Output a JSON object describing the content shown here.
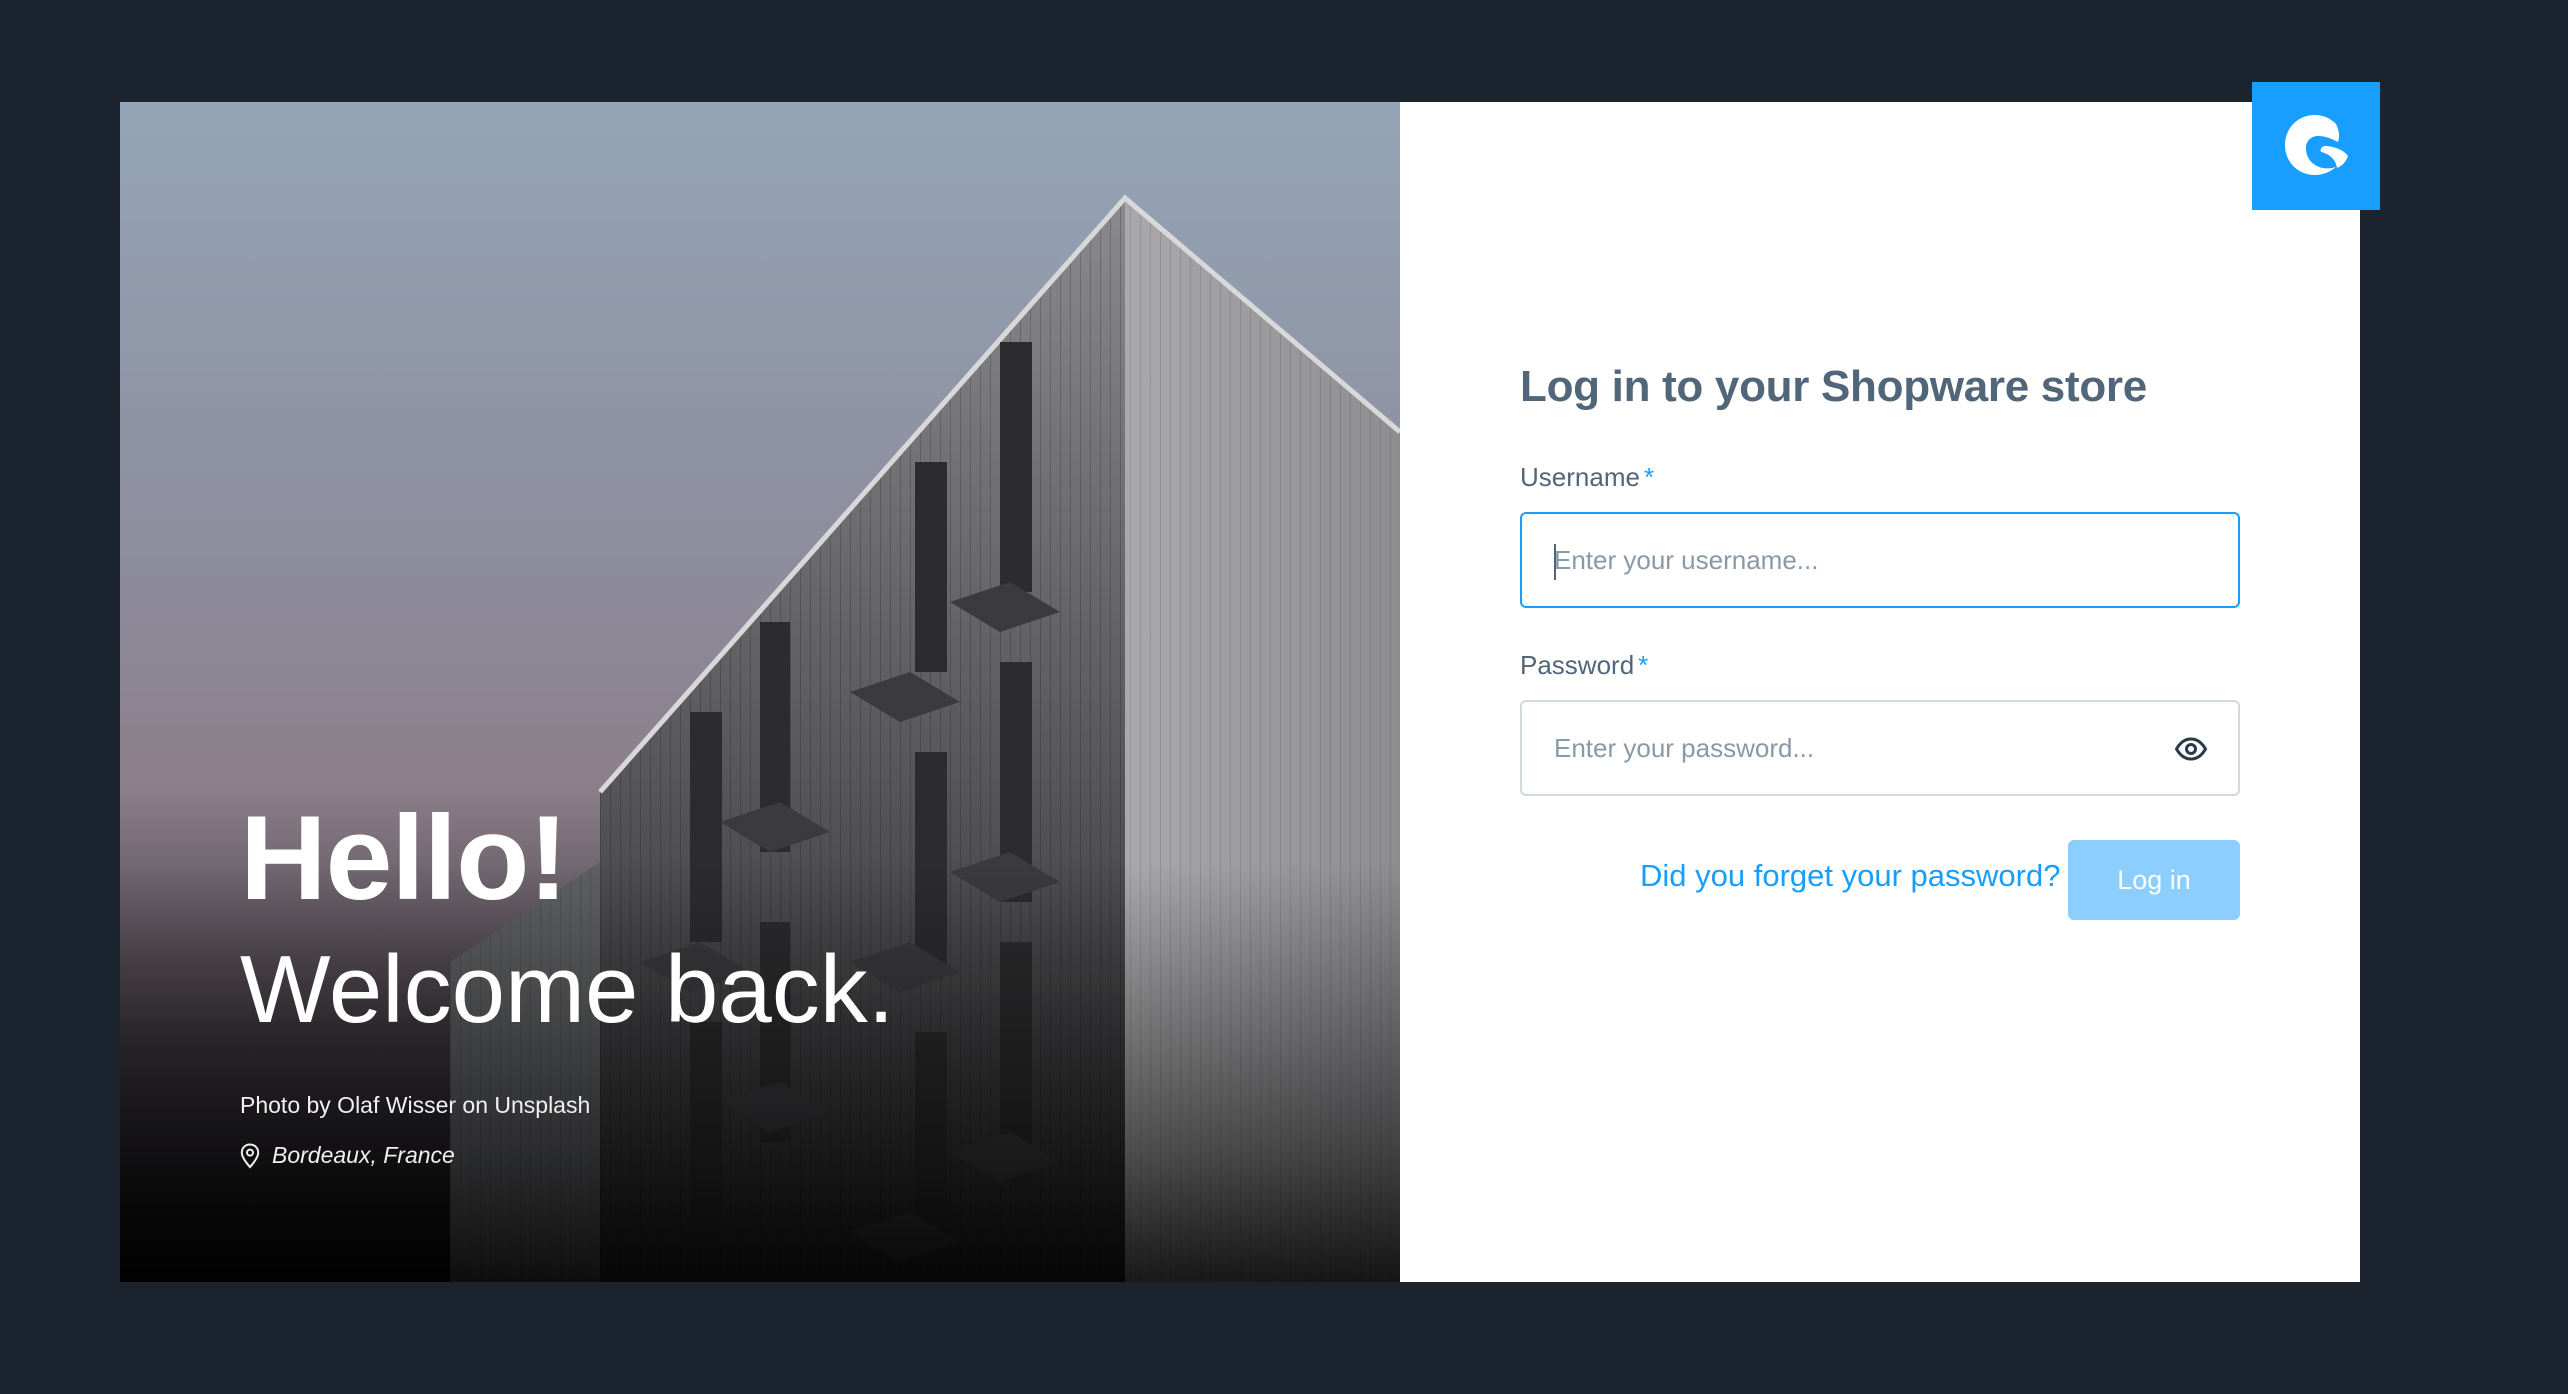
{
  "hero": {
    "hello": "Hello!",
    "welcome": "Welcome back.",
    "photo_credit": "Photo by Olaf Wisser on Unsplash",
    "location": "Bordeaux, France"
  },
  "login": {
    "title": "Log in to your Shopware store",
    "username_label": "Username",
    "username_placeholder": "Enter your username...",
    "password_label": "Password",
    "password_placeholder": "Enter your password...",
    "required_marker": "*",
    "forgot_link": "Did you forget your password?",
    "submit_label": "Log in"
  },
  "icons": {
    "logo": "shopware-logo-icon",
    "password_toggle": "eye-icon",
    "location": "map-pin-icon"
  },
  "colors": {
    "brand": "#189eff",
    "button_disabled": "#8ccfff",
    "text": "#52667a",
    "background": "#1b232f"
  }
}
